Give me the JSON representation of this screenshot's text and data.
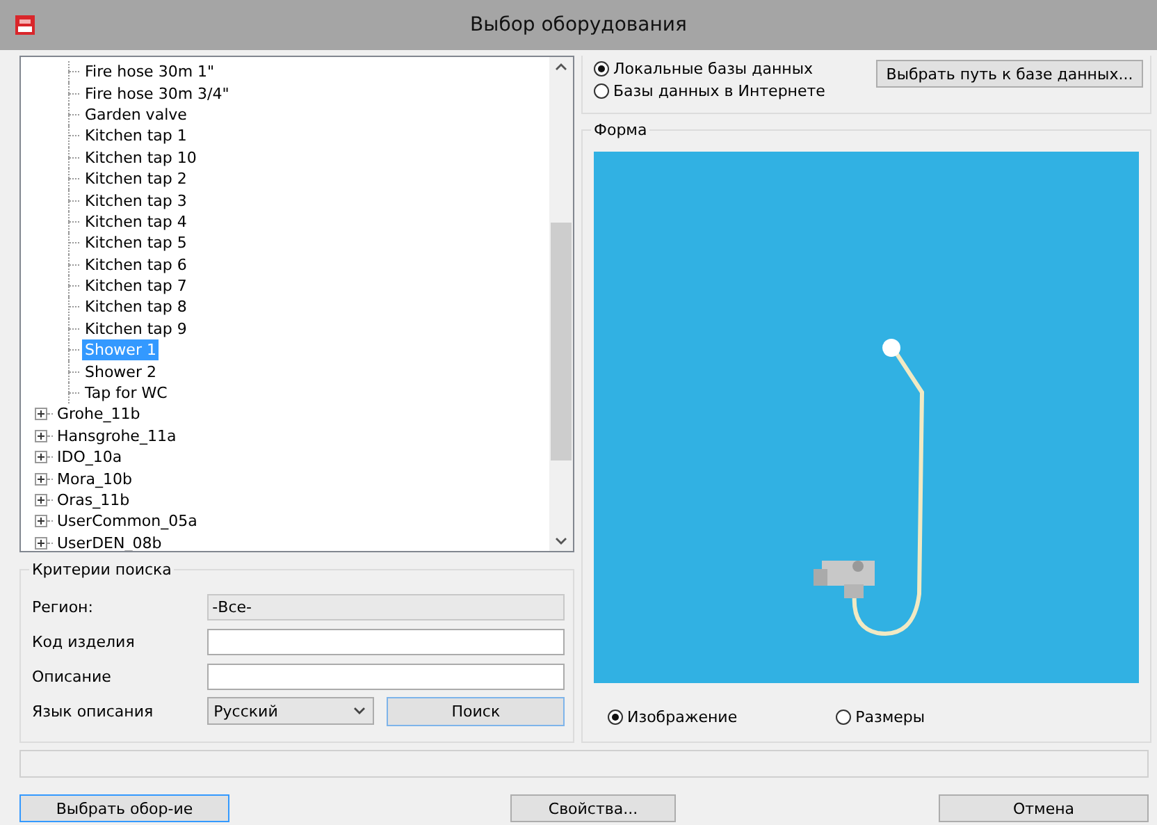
{
  "window": {
    "title": "Выбор оборудования"
  },
  "tree": {
    "items": [
      {
        "kind": "leaf",
        "label": "Fire hose 30m 1\"",
        "selected": false
      },
      {
        "kind": "leaf",
        "label": "Fire hose 30m 3/4\"",
        "selected": false
      },
      {
        "kind": "leaf",
        "label": "Garden valve",
        "selected": false
      },
      {
        "kind": "leaf",
        "label": "Kitchen tap 1",
        "selected": false
      },
      {
        "kind": "leaf",
        "label": "Kitchen tap 10",
        "selected": false
      },
      {
        "kind": "leaf",
        "label": "Kitchen tap 2",
        "selected": false
      },
      {
        "kind": "leaf",
        "label": "Kitchen tap 3",
        "selected": false
      },
      {
        "kind": "leaf",
        "label": "Kitchen tap 4",
        "selected": false
      },
      {
        "kind": "leaf",
        "label": "Kitchen tap 5",
        "selected": false
      },
      {
        "kind": "leaf",
        "label": "Kitchen tap 6",
        "selected": false
      },
      {
        "kind": "leaf",
        "label": "Kitchen tap 7",
        "selected": false
      },
      {
        "kind": "leaf",
        "label": "Kitchen tap 8",
        "selected": false
      },
      {
        "kind": "leaf",
        "label": "Kitchen tap 9",
        "selected": false
      },
      {
        "kind": "leaf",
        "label": "Shower 1",
        "selected": true
      },
      {
        "kind": "leaf",
        "label": "Shower 2",
        "selected": false
      },
      {
        "kind": "leaf",
        "label": "Tap for WC",
        "selected": false
      },
      {
        "kind": "node",
        "label": "Grohe_11b",
        "selected": false,
        "expanded": false
      },
      {
        "kind": "node",
        "label": "Hansgrohe_11a",
        "selected": false,
        "expanded": false
      },
      {
        "kind": "node",
        "label": "IDO_10a",
        "selected": false,
        "expanded": false
      },
      {
        "kind": "node",
        "label": "Mora_10b",
        "selected": false,
        "expanded": false
      },
      {
        "kind": "node",
        "label": "Oras_11b",
        "selected": false,
        "expanded": false
      },
      {
        "kind": "node",
        "label": "UserCommon_05a",
        "selected": false,
        "expanded": false
      },
      {
        "kind": "node",
        "label": "UserDEN_08b",
        "selected": false,
        "expanded": false
      }
    ]
  },
  "search": {
    "title": "Критерии поиска",
    "fields": [
      {
        "kind": "text",
        "label": "Регион:",
        "value": "-Все-",
        "disabled": true
      },
      {
        "kind": "text",
        "label": "Код изделия",
        "disabled": false
      },
      {
        "kind": "text",
        "label": "Описание",
        "disabled": false
      },
      {
        "kind": "combo",
        "label": "Язык описания",
        "value": "Русский",
        "disabled": false
      }
    ],
    "button": "Поиск"
  },
  "source": {
    "options": [
      {
        "label": "Локальные базы данных",
        "selected": true
      },
      {
        "label": "Базы данных в Интернете",
        "selected": false
      }
    ],
    "button": "Выбрать путь к базе данных..."
  },
  "preview": {
    "title": "Форма",
    "modes": [
      {
        "label": "Изображение",
        "selected": true
      },
      {
        "label": "Размеры",
        "selected": false
      }
    ]
  },
  "buttons": [
    {
      "label": "Выбрать обор-ие",
      "default": true
    },
    {
      "label": "Свойства...",
      "default": false
    },
    {
      "label": "Отмена",
      "default": false
    }
  ]
}
